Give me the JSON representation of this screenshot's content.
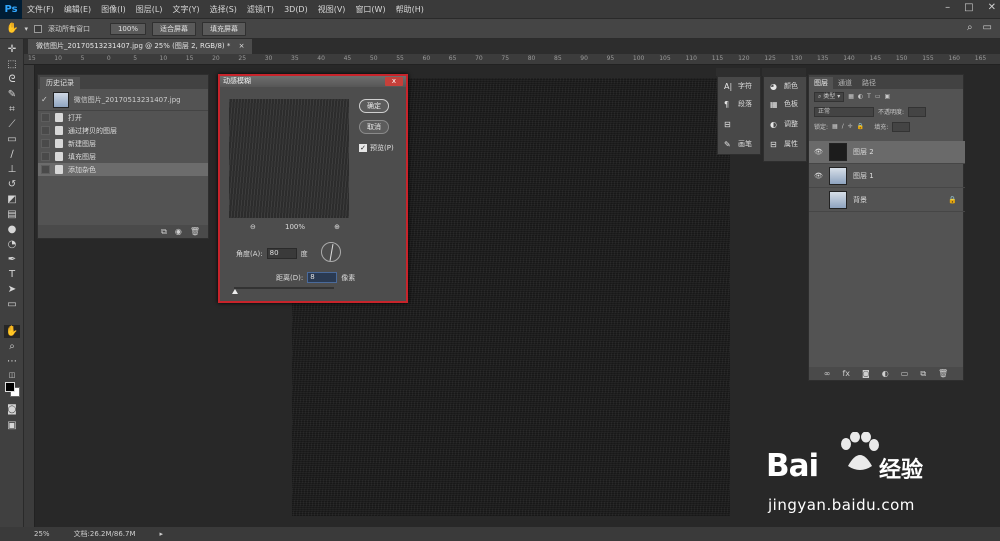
{
  "app": {
    "logo": "Ps"
  },
  "menu": [
    "文件(F)",
    "编辑(E)",
    "图像(I)",
    "图层(L)",
    "文字(Y)",
    "选择(S)",
    "滤镜(T)",
    "3D(D)",
    "视图(V)",
    "窗口(W)",
    "帮助(H)"
  ],
  "options": {
    "scroll_all_label": "滚动所有窗口",
    "zoom_100": "100%",
    "fit_screen": "适合屏幕",
    "fill_screen": "填充屏幕"
  },
  "document": {
    "tab_title": "微信图片_20170513231407.jpg @ 25% (图层 2, RGB/8) *"
  },
  "ruler": {
    "marks": [
      "15",
      "10",
      "5",
      "0",
      "5",
      "10",
      "15",
      "20",
      "25",
      "30",
      "35",
      "40",
      "45",
      "50",
      "55",
      "60",
      "65",
      "70",
      "75",
      "80",
      "85",
      "90",
      "95",
      "100",
      "105",
      "110",
      "115",
      "120",
      "125",
      "130",
      "135",
      "140",
      "145",
      "150",
      "155",
      "160",
      "165"
    ]
  },
  "history": {
    "tab": "历史记录",
    "snapshot": "微信图片_20170513231407.jpg",
    "items": [
      {
        "label": "打开",
        "selected": false
      },
      {
        "label": "通过拷贝的图层",
        "selected": false
      },
      {
        "label": "新建图层",
        "selected": false
      },
      {
        "label": "填充图层",
        "selected": false
      },
      {
        "label": "添加杂色",
        "selected": true
      }
    ]
  },
  "dialog": {
    "title": "动感模糊",
    "close": "x",
    "ok": "确定",
    "cancel": "取消",
    "preview_label": "预览(P)",
    "preview_checked": true,
    "zoom_out": "⊖",
    "zoom_level": "100%",
    "zoom_in": "⊕",
    "angle_label": "角度(A):",
    "angle_value": "80",
    "angle_unit": "度",
    "distance_label": "距离(D):",
    "distance_value": "8",
    "distance_unit": "像素"
  },
  "mini_panels": {
    "left": [
      {
        "label": "字符",
        "icon": "character-icon"
      },
      {
        "label": "段落",
        "icon": "paragraph-icon"
      },
      {
        "label": "",
        "icon": "properties-icon"
      },
      {
        "label": "画笔",
        "icon": "brush-icon"
      }
    ],
    "right": [
      {
        "label": "颜色",
        "icon": "color-icon"
      },
      {
        "label": "色板",
        "icon": "swatches-icon"
      },
      {
        "label": "调整",
        "icon": "adjustments-icon"
      },
      {
        "label": "属性",
        "icon": "properties-icon"
      }
    ]
  },
  "layers": {
    "tabs": [
      "图层",
      "通道",
      "路径"
    ],
    "filter_kind": "类型",
    "blend_mode": "正常",
    "opacity_label": "不透明度:",
    "lock_label": "锁定:",
    "fill_label": "填充:",
    "items": [
      {
        "name": "图层 2",
        "visible": true,
        "selected": true,
        "thumb": "dark"
      },
      {
        "name": "图层 1",
        "visible": true,
        "selected": false,
        "thumb": "photo"
      },
      {
        "name": "背景",
        "visible": false,
        "selected": false,
        "thumb": "photo",
        "locked": true
      }
    ]
  },
  "status": {
    "zoom": "25%",
    "doc": "文档:26.2M/86.7M"
  },
  "watermark": {
    "brand": "Bai",
    "brand_cn": "经验",
    "url": "jingyan.baidu.com"
  }
}
